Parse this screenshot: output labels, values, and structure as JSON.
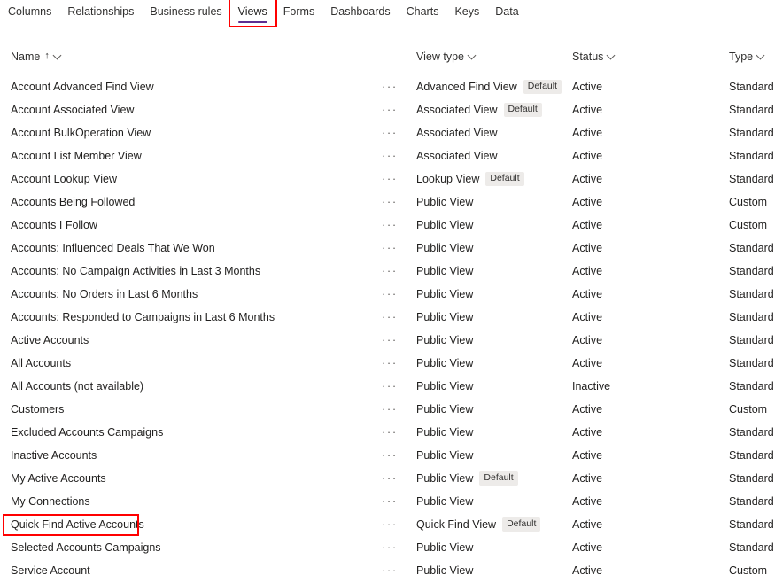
{
  "tabs": [
    {
      "label": "Columns",
      "active": false,
      "annotated": false
    },
    {
      "label": "Relationships",
      "active": false,
      "annotated": false
    },
    {
      "label": "Business rules",
      "active": false,
      "annotated": false
    },
    {
      "label": "Views",
      "active": true,
      "annotated": true
    },
    {
      "label": "Forms",
      "active": false,
      "annotated": false
    },
    {
      "label": "Dashboards",
      "active": false,
      "annotated": false
    },
    {
      "label": "Charts",
      "active": false,
      "annotated": false
    },
    {
      "label": "Keys",
      "active": false,
      "annotated": false
    },
    {
      "label": "Data",
      "active": false,
      "annotated": false
    }
  ],
  "columns": [
    {
      "label": "Name",
      "sorted": "ascending",
      "sort_glyph": "↑",
      "chevron": "chevron-down-icon"
    },
    {
      "label": "View type",
      "sorted": "none",
      "sort_glyph": "",
      "chevron": "chevron-down-icon"
    },
    {
      "label": "Status",
      "sorted": "none",
      "sort_glyph": "",
      "chevron": "chevron-down-icon"
    },
    {
      "label": "Type",
      "sorted": "none",
      "sort_glyph": "",
      "chevron": "chevron-down-icon"
    }
  ],
  "row_overflow_glyph": "···",
  "default_badge_label": "Default",
  "annotation_color": "#ff0000",
  "accent_color": "#5c2e91",
  "rows": [
    {
      "name": "Account Advanced Find View",
      "view_type": "Advanced Find View",
      "default": true,
      "status": "Active",
      "type": "Standard",
      "annotated": false
    },
    {
      "name": "Account Associated View",
      "view_type": "Associated View",
      "default": true,
      "status": "Active",
      "type": "Standard",
      "annotated": false
    },
    {
      "name": "Account BulkOperation View",
      "view_type": "Associated View",
      "default": false,
      "status": "Active",
      "type": "Standard",
      "annotated": false
    },
    {
      "name": "Account List Member View",
      "view_type": "Associated View",
      "default": false,
      "status": "Active",
      "type": "Standard",
      "annotated": false
    },
    {
      "name": "Account Lookup View",
      "view_type": "Lookup View",
      "default": true,
      "status": "Active",
      "type": "Standard",
      "annotated": false
    },
    {
      "name": "Accounts Being Followed",
      "view_type": "Public View",
      "default": false,
      "status": "Active",
      "type": "Custom",
      "annotated": false
    },
    {
      "name": "Accounts I Follow",
      "view_type": "Public View",
      "default": false,
      "status": "Active",
      "type": "Custom",
      "annotated": false
    },
    {
      "name": "Accounts: Influenced Deals That We Won",
      "view_type": "Public View",
      "default": false,
      "status": "Active",
      "type": "Standard",
      "annotated": false
    },
    {
      "name": "Accounts: No Campaign Activities in Last 3 Months",
      "view_type": "Public View",
      "default": false,
      "status": "Active",
      "type": "Standard",
      "annotated": false
    },
    {
      "name": "Accounts: No Orders in Last 6 Months",
      "view_type": "Public View",
      "default": false,
      "status": "Active",
      "type": "Standard",
      "annotated": false
    },
    {
      "name": "Accounts: Responded to Campaigns in Last 6 Months",
      "view_type": "Public View",
      "default": false,
      "status": "Active",
      "type": "Standard",
      "annotated": false
    },
    {
      "name": "Active Accounts",
      "view_type": "Public View",
      "default": false,
      "status": "Active",
      "type": "Standard",
      "annotated": false
    },
    {
      "name": "All Accounts",
      "view_type": "Public View",
      "default": false,
      "status": "Active",
      "type": "Standard",
      "annotated": false
    },
    {
      "name": "All Accounts (not available)",
      "view_type": "Public View",
      "default": false,
      "status": "Inactive",
      "type": "Standard",
      "annotated": false
    },
    {
      "name": "Customers",
      "view_type": "Public View",
      "default": false,
      "status": "Active",
      "type": "Custom",
      "annotated": false
    },
    {
      "name": "Excluded Accounts Campaigns",
      "view_type": "Public View",
      "default": false,
      "status": "Active",
      "type": "Standard",
      "annotated": false
    },
    {
      "name": "Inactive Accounts",
      "view_type": "Public View",
      "default": false,
      "status": "Active",
      "type": "Standard",
      "annotated": false
    },
    {
      "name": "My Active Accounts",
      "view_type": "Public View",
      "default": true,
      "status": "Active",
      "type": "Standard",
      "annotated": false
    },
    {
      "name": "My Connections",
      "view_type": "Public View",
      "default": false,
      "status": "Active",
      "type": "Standard",
      "annotated": false
    },
    {
      "name": "Quick Find Active Accounts",
      "view_type": "Quick Find View",
      "default": true,
      "status": "Active",
      "type": "Standard",
      "annotated": true
    },
    {
      "name": "Selected Accounts Campaigns",
      "view_type": "Public View",
      "default": false,
      "status": "Active",
      "type": "Standard",
      "annotated": false
    },
    {
      "name": "Service Account",
      "view_type": "Public View",
      "default": false,
      "status": "Active",
      "type": "Custom",
      "annotated": false
    }
  ]
}
